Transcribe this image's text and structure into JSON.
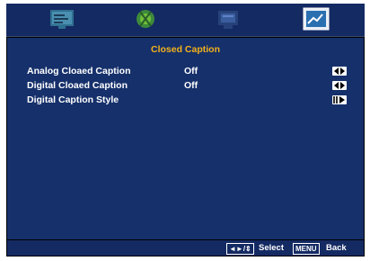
{
  "tabs": [
    {
      "icon": "picture-icon"
    },
    {
      "icon": "audio-icon"
    },
    {
      "icon": "setup-icon"
    },
    {
      "icon": "caption-icon",
      "selected": true
    }
  ],
  "menu": {
    "title": "Closed Caption",
    "rows": [
      {
        "label": "Analog Cloaed Caption",
        "value": "Off",
        "control": "left-right-arrows-icon"
      },
      {
        "label": "Digital Cloaed Caption",
        "value": "Off",
        "control": "left-right-arrows-icon"
      },
      {
        "label": "Digital Caption Style",
        "value": "",
        "control": "enter-arrow-icon"
      }
    ]
  },
  "footer": {
    "select_key": "◄►/⇕",
    "select_label": "Select",
    "back_key": "MENU",
    "back_label": "Back"
  },
  "colors": {
    "panel": "#16306b",
    "title": "#f3b21b",
    "text": "#ffffff"
  }
}
